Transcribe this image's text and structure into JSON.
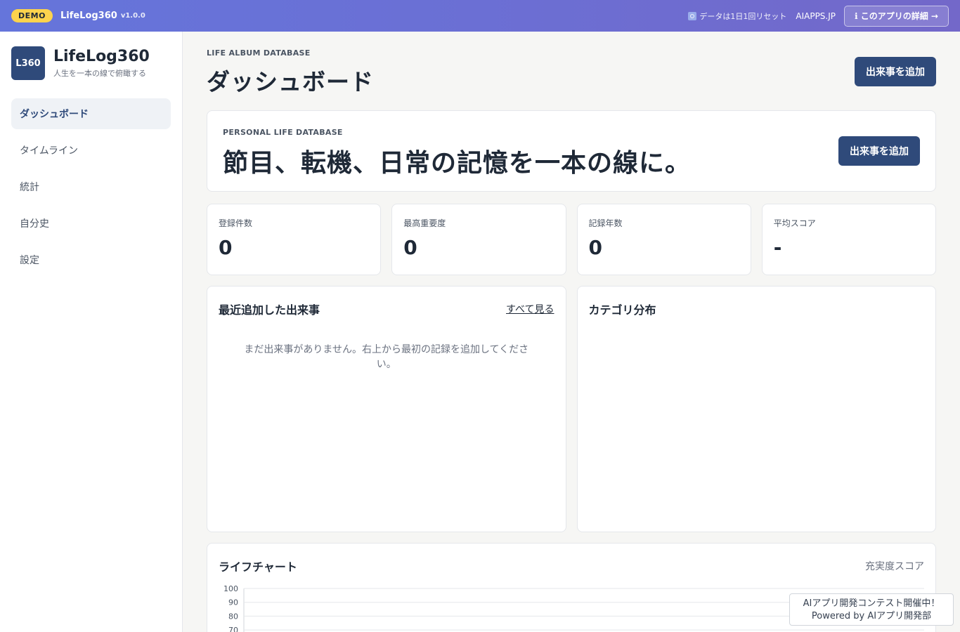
{
  "topbar": {
    "demo_badge": "DEMO",
    "app_name": "LifeLog360",
    "version": "v1.0.0",
    "reset_note": "データは1日1回リセット",
    "site_link": "AIAPPS.JP",
    "about_button": "ℹ このアプリの詳細 →"
  },
  "sidebar": {
    "logo": "L360",
    "title": "LifeLog360",
    "subtitle": "人生を一本の線で俯瞰する",
    "items": [
      {
        "label": "ダッシュボード",
        "active": true
      },
      {
        "label": "タイムライン"
      },
      {
        "label": "統計"
      },
      {
        "label": "自分史"
      },
      {
        "label": "設定"
      }
    ]
  },
  "header": {
    "eyebrow": "LIFE ALBUM DATABASE",
    "title": "ダッシュボード",
    "add_button": "出来事を追加"
  },
  "hero": {
    "eyebrow": "PERSONAL LIFE DATABASE",
    "title": "節目、転機、日常の記憶を一本の線に。",
    "add_button": "出来事を追加"
  },
  "stats": [
    {
      "label": "登録件数",
      "value": "0"
    },
    {
      "label": "最高重要度",
      "value": "0"
    },
    {
      "label": "記録年数",
      "value": "0"
    },
    {
      "label": "平均スコア",
      "value": "-"
    }
  ],
  "recent": {
    "title": "最近追加した出来事",
    "see_all": "すべて見る",
    "empty": "まだ出来事がありません。右上から最初の記録を追加してください。"
  },
  "category": {
    "title": "カテゴリ分布"
  },
  "life_chart": {
    "title": "ライフチャート",
    "subtitle": "充実度スコア"
  },
  "chart_data": {
    "type": "line",
    "title": "ライフチャート",
    "ylabel": "充実度スコア",
    "y_ticks": [
      100,
      90,
      80,
      70
    ],
    "ylim": [
      0,
      100
    ],
    "series": [],
    "grid": true
  },
  "contest": {
    "line1": "AIアプリ開発コンテスト開催中！",
    "line2": "Powered by AIアプリ開発部"
  }
}
